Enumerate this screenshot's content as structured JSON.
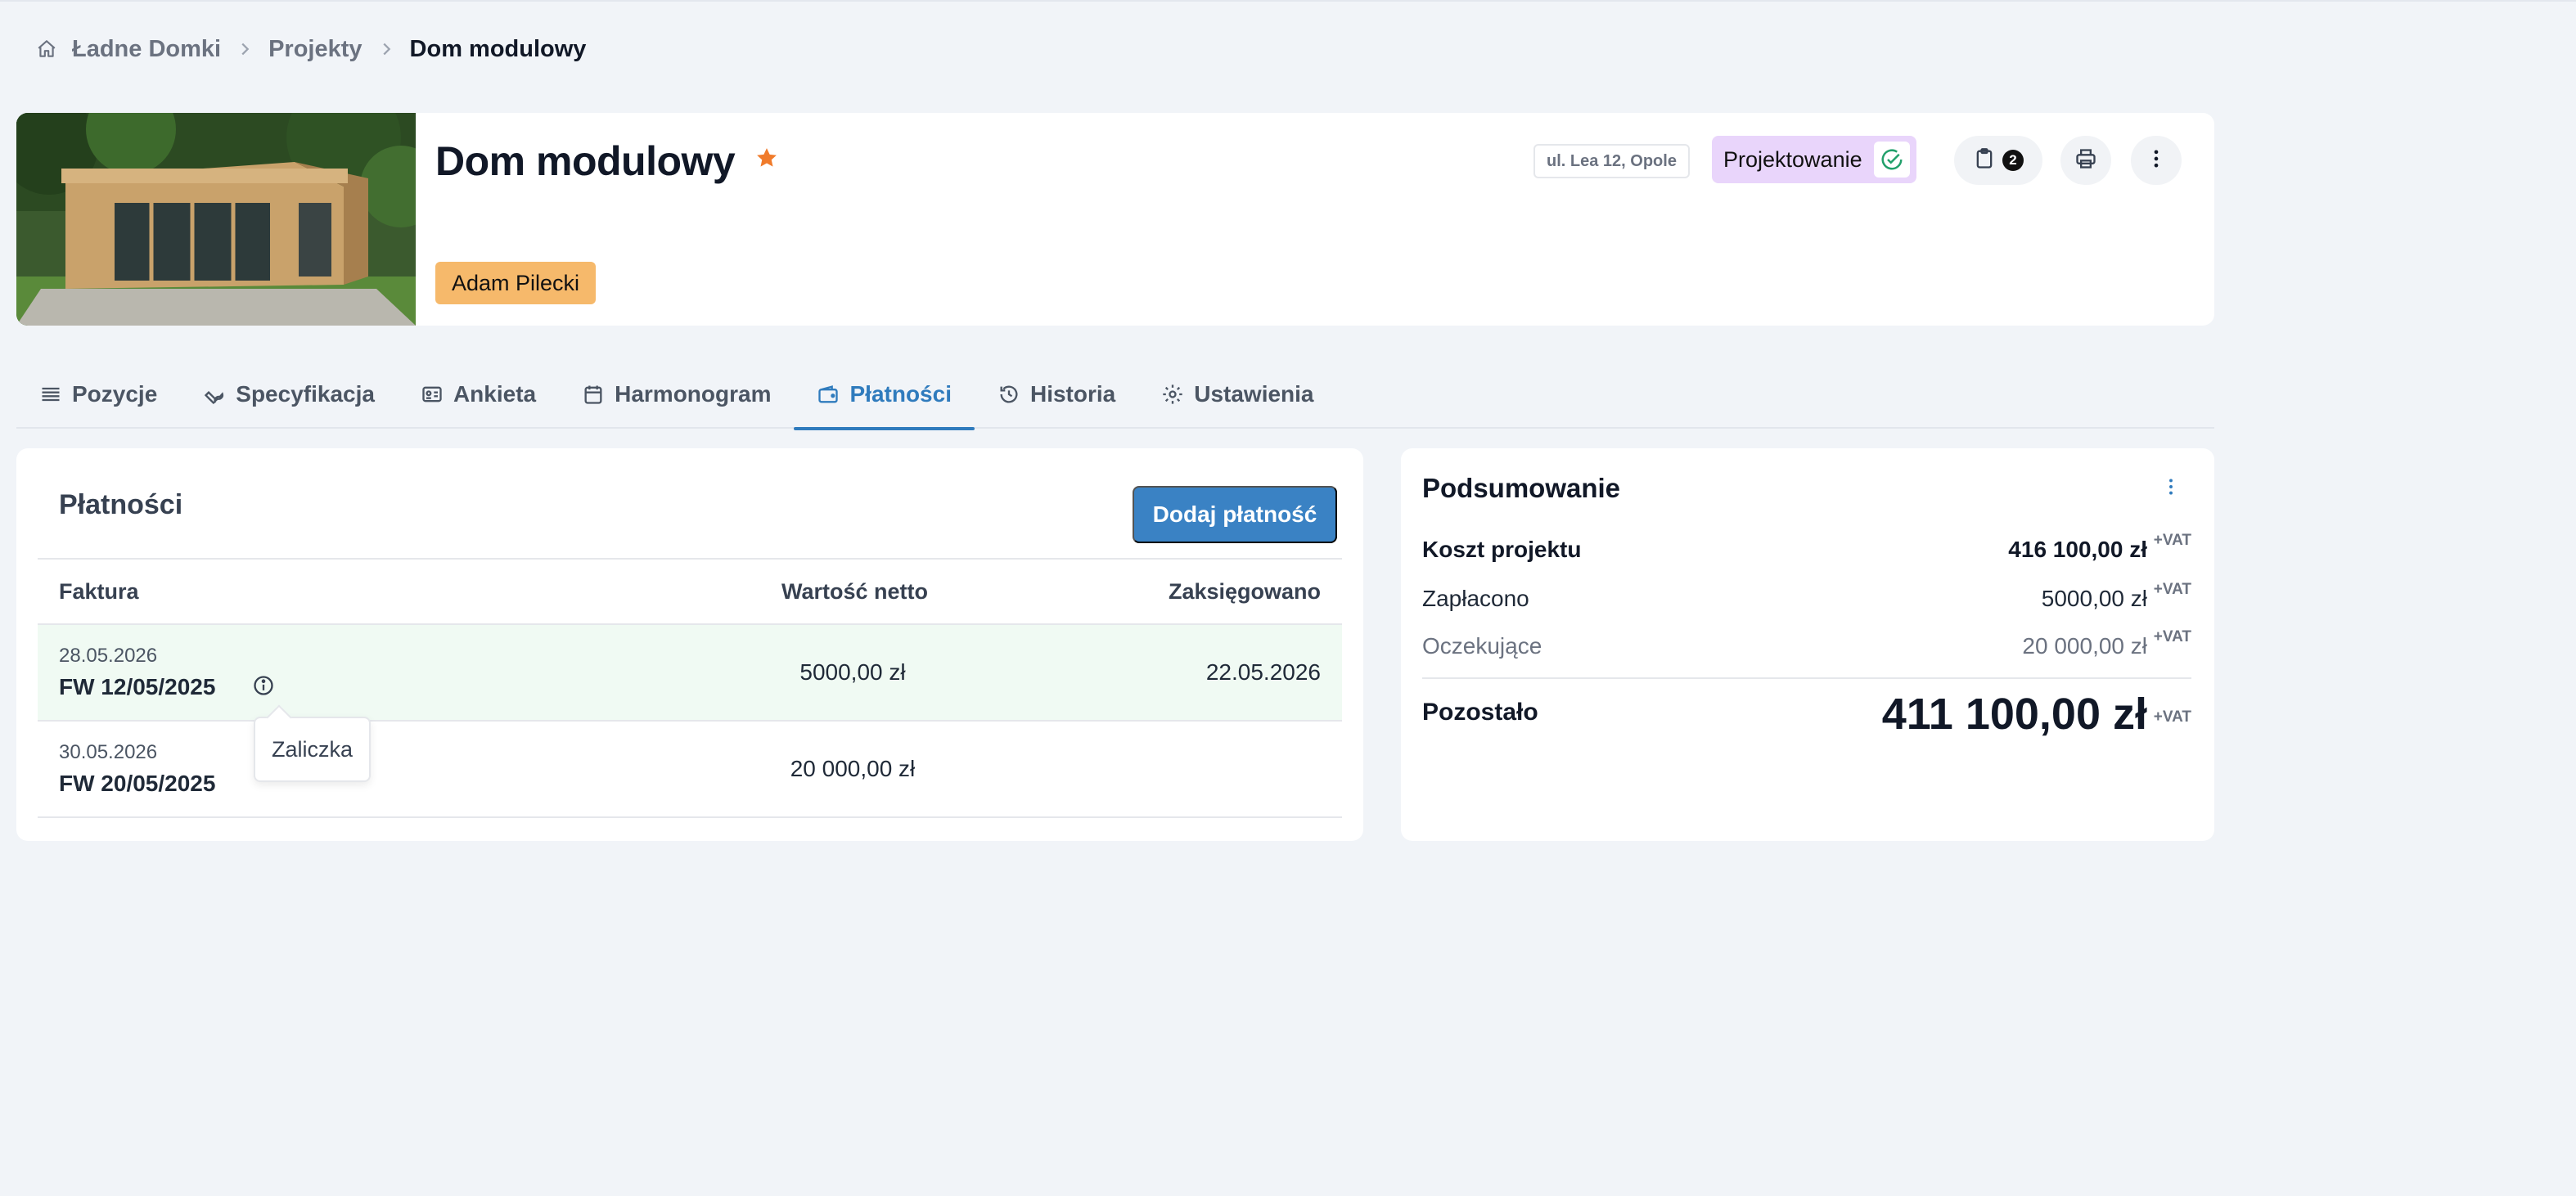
{
  "breadcrumb": {
    "items": [
      "Ładne Domki",
      "Projekty",
      "Dom modulowy"
    ]
  },
  "header": {
    "title": "Dom modulowy",
    "owner": "Adam Pilecki",
    "address": "ul. Lea 12, Opole",
    "status": "Projektowanie",
    "notes_count": "2",
    "icons": {
      "favorite": "star-icon",
      "notes": "clipboard-icon",
      "print": "printer-icon",
      "more": "kebab-menu-icon"
    },
    "colors": {
      "star": "#f07b2b",
      "status_bg": "#e9d5fb",
      "owner_bg": "#f6b96b"
    }
  },
  "tabs": [
    {
      "label": "Pozycje",
      "icon": "list-icon"
    },
    {
      "label": "Specyfikacja",
      "icon": "wrench-icon"
    },
    {
      "label": "Ankieta",
      "icon": "id-card-icon"
    },
    {
      "label": "Harmonogram",
      "icon": "calendar-icon"
    },
    {
      "label": "Płatności",
      "icon": "wallet-icon",
      "active": true
    },
    {
      "label": "Historia",
      "icon": "history-icon"
    },
    {
      "label": "Ustawienia",
      "icon": "gear-icon"
    }
  ],
  "payments": {
    "title": "Płatności",
    "add_button": "Dodaj płatność",
    "columns": {
      "invoice": "Faktura",
      "net": "Wartość netto",
      "booked": "Zaksięgowano"
    },
    "rows": [
      {
        "date": "28.05.2026",
        "number": "FW 12/05/2025",
        "net": "5000,00 zł",
        "booked": "22.05.2026"
      },
      {
        "date": "30.05.2026",
        "number": "FW 20/05/2025",
        "net": "20 000,00 zł",
        "booked": ""
      }
    ],
    "tooltip": "Zaliczka",
    "accent": "#3a82c4"
  },
  "summary": {
    "title": "Podsumowanie",
    "vat_suffix": "+VAT",
    "project_cost": {
      "label": "Koszt projektu",
      "value": "416 100,00 zł"
    },
    "paid": {
      "label": "Zapłacono",
      "value": "5000,00 zł"
    },
    "pending": {
      "label": "Oczekujące",
      "value": "20 000,00 zł"
    },
    "remaining": {
      "label": "Pozostało",
      "value": "411 100,00 zł"
    }
  }
}
